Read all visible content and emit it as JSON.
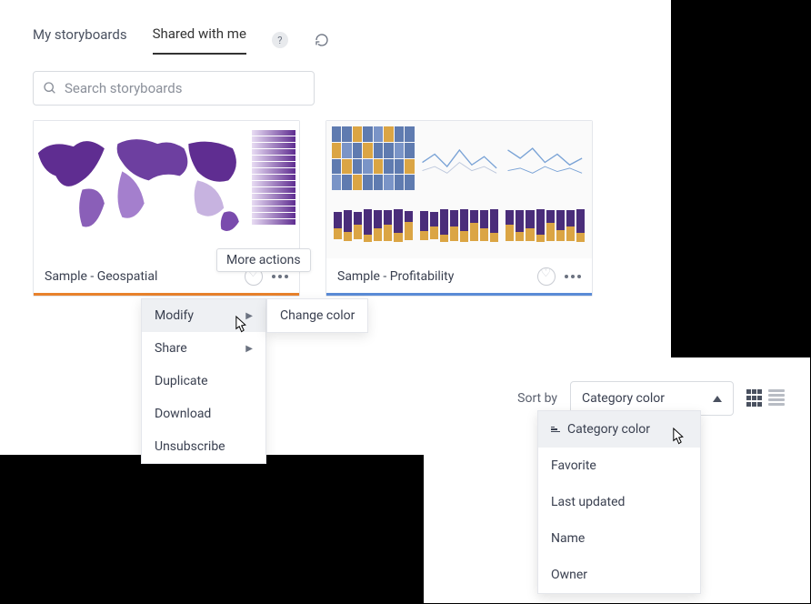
{
  "tabs": {
    "my": "My storyboards",
    "shared": "Shared with me"
  },
  "search": {
    "placeholder": "Search storyboards"
  },
  "tooltip_more_actions": "More actions",
  "cards": [
    {
      "title": "Sample - Geospatial"
    },
    {
      "title": "Sample - Profitability"
    }
  ],
  "context_menu": {
    "modify": "Modify",
    "share": "Share",
    "duplicate": "Duplicate",
    "download": "Download",
    "unsubscribe": "Unsubscribe",
    "change_color": "Change color"
  },
  "sort": {
    "label": "Sort by",
    "selected": "Category color",
    "options": {
      "category_color": "Category color",
      "favorite": "Favorite",
      "last_updated": "Last updated",
      "name": "Name",
      "owner": "Owner"
    }
  }
}
